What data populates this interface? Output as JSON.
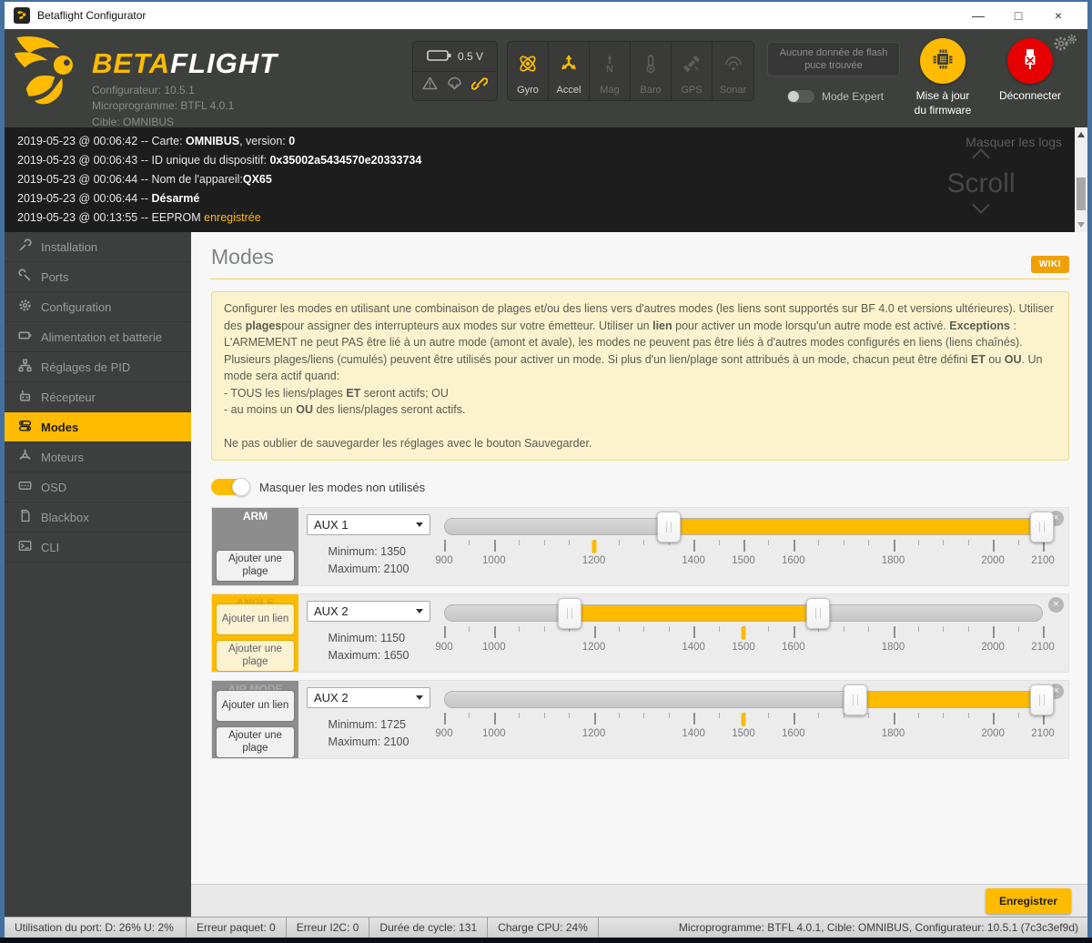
{
  "window": {
    "title": "Betaflight Configurator"
  },
  "colors": {
    "accent": "#ffbb00",
    "disconnect_red": "#e60000",
    "selected_mode_yellow": "#ffbb00"
  },
  "header": {
    "brand": {
      "beta": "BETA",
      "flight": "FLIGHT"
    },
    "info_lines": [
      "Configurateur: 10.5.1",
      "Microprogramme: BTFL 4.0.1",
      "Cible: OMNIBUS"
    ],
    "battery": {
      "voltage": "0.5 V"
    },
    "sensors": [
      {
        "label": "Gyro",
        "icon": "gyro",
        "active": true
      },
      {
        "label": "Accel",
        "icon": "accel",
        "active": true
      },
      {
        "label": "Mag",
        "icon": "mag",
        "active": false
      },
      {
        "label": "Baro",
        "icon": "baro",
        "active": false
      },
      {
        "label": "GPS",
        "icon": "gps",
        "active": false
      },
      {
        "label": "Sonar",
        "icon": "sonar",
        "active": false
      }
    ],
    "flash_button": "Aucune donnée de flash puce trouvée",
    "expert_toggle_label": "Mode Expert",
    "firmware_button": "Mise à jour du firmware",
    "disconnect_button": "Déconnecter"
  },
  "log": {
    "hide_label": "Masquer les logs",
    "scroll_label": "Scroll",
    "lines": [
      [
        {
          "t": "2019-05-23 @ 00:06:42 -- Carte: "
        },
        {
          "t": "OMNIBUS",
          "b": true
        },
        {
          "t": ", version: "
        },
        {
          "t": "0",
          "b": true
        }
      ],
      [
        {
          "t": "2019-05-23 @ 00:06:43 -- ID unique du dispositif: "
        },
        {
          "t": "0x35002a5434570e20333734",
          "b": true
        }
      ],
      [
        {
          "t": "2019-05-23 @ 00:06:44 -- Nom de l'appareil:"
        },
        {
          "t": "QX65",
          "b": true
        }
      ],
      [
        {
          "t": "2019-05-23 @ 00:06:44 -- "
        },
        {
          "t": "Désarmé",
          "b": true
        }
      ],
      [
        {
          "t": "2019-05-23 @ 00:13:55 -- EEPROM "
        },
        {
          "t": "enregistrée",
          "y": true
        }
      ]
    ]
  },
  "sidebar": {
    "items": [
      {
        "label": "Installation",
        "icon": "installation"
      },
      {
        "label": "Ports",
        "icon": "ports"
      },
      {
        "label": "Configuration",
        "icon": "configuration"
      },
      {
        "label": "Alimentation et batterie",
        "icon": "alimentation"
      },
      {
        "label": "Réglages de PID",
        "icon": "pid"
      },
      {
        "label": "Récepteur",
        "icon": "recepteur"
      },
      {
        "label": "Modes",
        "icon": "modes"
      },
      {
        "label": "Moteurs",
        "icon": "moteurs"
      },
      {
        "label": "OSD",
        "icon": "osd"
      },
      {
        "label": "Blackbox",
        "icon": "blackbox"
      },
      {
        "label": "CLI",
        "icon": "cli"
      }
    ],
    "selected_index": 6
  },
  "content": {
    "title": "Modes",
    "wiki_label": "WIKI",
    "note_paragraphs": [
      {
        "segments": [
          {
            "t": "Configurer les modes en utilisant une combinaison de plages et/ou des liens vers d'autres modes (les liens sont supportés sur BF 4.0 et versions ultérieures). Utiliser des "
          },
          {
            "t": "plages",
            "b": true
          },
          {
            "t": "pour assigner des interrupteurs aux modes sur votre émetteur. Utiliser un "
          },
          {
            "t": "lien",
            "b": true
          },
          {
            "t": " pour activer un mode lorsqu'un autre mode est activé. "
          },
          {
            "t": "Exceptions",
            "b": true
          },
          {
            "t": " : L'ARMEMENT ne peut PAS être lié à un autre mode (amont et avale), les modes ne peuvent pas être liés à d'autres modes configurés en liens (liens chaînés). Plusieurs plages/liens (cumulés) peuvent être utilisés pour activer un mode. Si plus d'un lien/plage sont attribués à un mode, chacun peut être défini "
          },
          {
            "t": "ET",
            "b": true
          },
          {
            "t": " ou "
          },
          {
            "t": "OU",
            "b": true
          },
          {
            "t": ". Un mode sera actif quand:"
          }
        ]
      },
      {
        "segments": [
          {
            "t": "- TOUS les liens/plages "
          },
          {
            "t": "ET",
            "b": true
          },
          {
            "t": " seront actifs; OU"
          }
        ]
      },
      {
        "segments": [
          {
            "t": "- au moins un "
          },
          {
            "t": "OU",
            "b": true
          },
          {
            "t": " des liens/plages seront actifs."
          }
        ]
      },
      {
        "gap": true,
        "segments": [
          {
            "t": "Ne pas oublier de sauvegarder les réglages avec le bouton Sauvegarder."
          }
        ]
      }
    ],
    "hide_unused_label": "Masquer les modes non utilisés",
    "scale": {
      "min": 900,
      "max": 2100,
      "minor_step": 50,
      "labels": [
        900,
        1000,
        1200,
        1400,
        1500,
        1600,
        1800,
        2000,
        2100
      ]
    },
    "rows": [
      {
        "name": "ARM",
        "style": "gray",
        "name_dim": false,
        "buttons": [
          "Ajouter une plage"
        ],
        "aux": "AUX 1",
        "min_text": "Minimum: 1350",
        "max_text": "Maximum: 2100",
        "min": 1350,
        "max": 2100,
        "marker": 1200
      },
      {
        "name": "ANGLE",
        "style": "yellow",
        "name_dim": false,
        "buttons": [
          "Ajouter un lien",
          "Ajouter une plage"
        ],
        "aux": "AUX 2",
        "min_text": "Minimum: 1150",
        "max_text": "Maximum: 1650",
        "min": 1150,
        "max": 1650,
        "marker": 1500
      },
      {
        "name": "AIR MODE",
        "style": "gray",
        "name_dim": true,
        "buttons": [
          "Ajouter un lien",
          "Ajouter une plage"
        ],
        "aux": "AUX 2",
        "min_text": "Minimum: 1725",
        "max_text": "Maximum: 2100",
        "min": 1725,
        "max": 2100,
        "marker": 1500
      }
    ],
    "save_label": "Enregistrer"
  },
  "statusbar": {
    "cells": [
      "Utilisation du port: D: 26% U: 2%",
      "Erreur paquet: 0",
      "Erreur I2C: 0",
      "Durée de cycle: 131",
      "Charge CPU: 24%"
    ],
    "right": "Microprogramme: BTFL 4.0.1, Cible: OMNIBUS, Configurateur: 10.5.1 (7c3c3ef9d)"
  }
}
